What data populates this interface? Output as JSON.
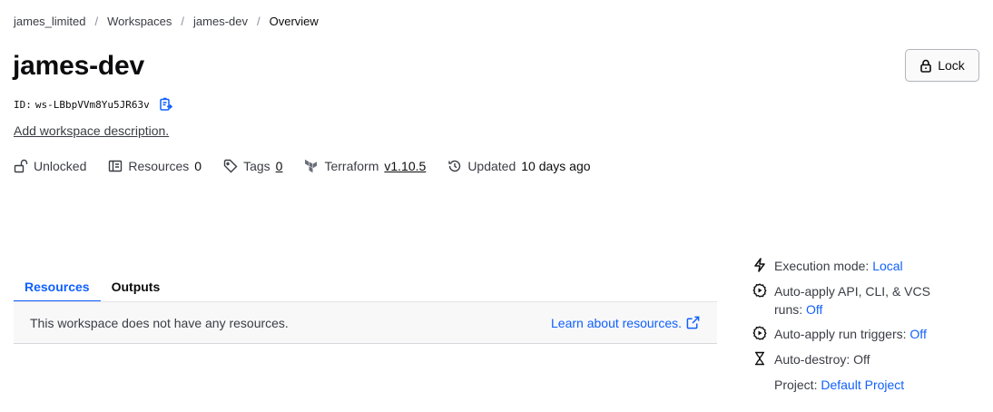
{
  "breadcrumb": {
    "org": "james_limited",
    "workspaces": "Workspaces",
    "workspace": "james-dev",
    "current": "Overview",
    "separator": "/"
  },
  "header": {
    "title": "james-dev",
    "lock_label": "Lock",
    "id_label": "ID:",
    "id_value": "ws-LBbpVVm8Yu5JR63v",
    "add_description": "Add workspace description."
  },
  "meta": {
    "lock_status": "Unlocked",
    "resources_label": "Resources",
    "resources_count": "0",
    "tags_label": "Tags",
    "tags_count": "0",
    "terraform_label": "Terraform",
    "terraform_version": "v1.10.5",
    "updated_label": "Updated",
    "updated_value": "10 days ago"
  },
  "tabs": [
    {
      "label": "Resources",
      "active": true
    },
    {
      "label": "Outputs",
      "active": false
    }
  ],
  "panel": {
    "message": "This workspace does not have any resources.",
    "learn_link": "Learn about resources."
  },
  "sidebar": {
    "execution_mode_label": "Execution mode:",
    "execution_mode_value": "Local",
    "auto_apply_label_line1": "Auto-apply API, CLI, & VCS",
    "auto_apply_label_line2": "runs:",
    "auto_apply_value": "Off",
    "auto_apply_triggers_label": "Auto-apply run triggers:",
    "auto_apply_triggers_value": "Off",
    "auto_destroy_label": "Auto-destroy:",
    "auto_destroy_value": "Off",
    "project_label": "Project:",
    "project_value": "Default Project"
  },
  "colors": {
    "accent": "#1060ff",
    "text": "#3b3d45",
    "heading": "#0c0c0e"
  },
  "icons": [
    "lock-icon",
    "copy-icon",
    "unlocked-icon",
    "resources-icon",
    "tag-icon",
    "terraform-icon",
    "history-icon",
    "external-link-icon",
    "lightning-icon",
    "auto-apply-icon",
    "run-triggers-icon",
    "hourglass-icon"
  ]
}
